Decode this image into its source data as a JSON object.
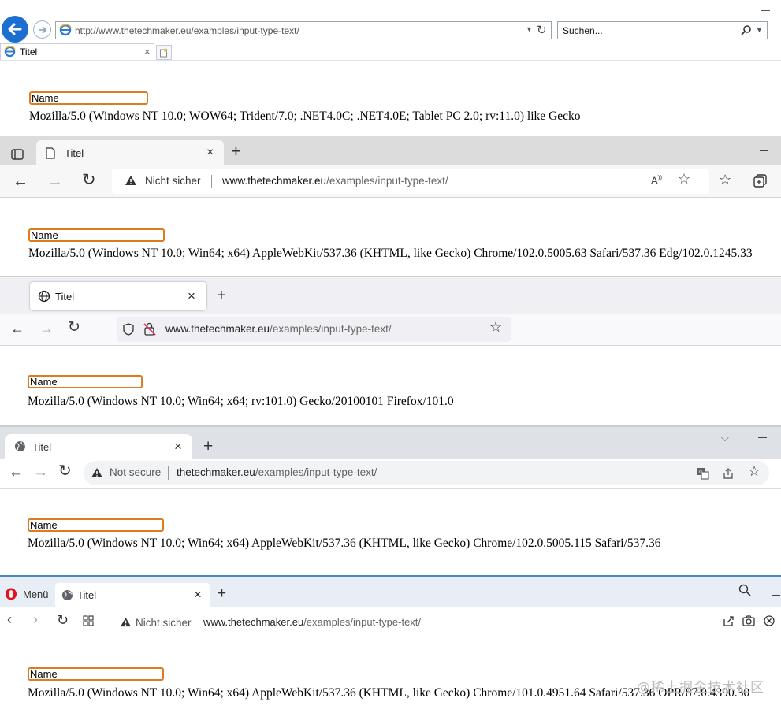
{
  "ie": {
    "url": "http://www.thetechmaker.eu/examples/input-type-text/",
    "search_placeholder": "Suchen...",
    "tab_title": "Titel",
    "input_value": "Name",
    "user_agent": "Mozilla/5.0 (Windows NT 10.0; WOW64; Trident/7.0; .NET4.0C; .NET4.0E; Tablet PC 2.0; rv:11.0) like Gecko"
  },
  "edge": {
    "tab_title": "Titel",
    "security_label": "Nicht sicher",
    "url_host": "www.thetechmaker.eu",
    "url_path": "/examples/input-type-text/",
    "input_value": "Name",
    "user_agent": "Mozilla/5.0 (Windows NT 10.0; Win64; x64) AppleWebKit/537.36 (KHTML, like Gecko) Chrome/102.0.5005.63 Safari/537.36 Edg/102.0.1245.33"
  },
  "firefox": {
    "tab_title": "Titel",
    "url_host": "www.thetechmaker.eu",
    "url_path": "/examples/input-type-text/",
    "input_value": "Name",
    "user_agent": "Mozilla/5.0 (Windows NT 10.0; Win64; x64; rv:101.0) Gecko/20100101 Firefox/101.0"
  },
  "chrome": {
    "tab_title": "Titel",
    "security_label": "Not secure",
    "url_host": "thetechmaker.eu",
    "url_path": "/examples/input-type-text/",
    "input_value": "Name",
    "user_agent": "Mozilla/5.0 (Windows NT 10.0; Win64; x64) AppleWebKit/537.36 (KHTML, like Gecko) Chrome/102.0.5005.115 Safari/537.36"
  },
  "opera": {
    "menu_label": "Menü",
    "tab_title": "Titel",
    "security_label": "Nicht sicher",
    "url_host": "www.thetechmaker.eu",
    "url_path": "/examples/input-type-text/",
    "input_value": "Name",
    "user_agent": "Mozilla/5.0 (Windows NT 10.0; Win64; x64) AppleWebKit/537.36 (KHTML, like Gecko) Chrome/101.0.4951.64 Safari/537.36 OPR/87.0.4390.30"
  },
  "watermark": "@稀土掘金技术社区",
  "colors": {
    "input_border": "#e07a1f",
    "ie_blue": "#1a6fd0",
    "opera_red": "#e0141e"
  }
}
